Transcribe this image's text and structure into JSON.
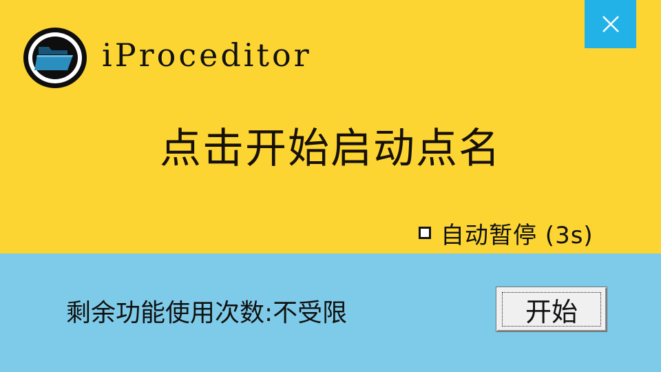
{
  "window": {
    "title": "iProceditor",
    "close_icon": "close-icon",
    "logo_icon": "folder-icon"
  },
  "main": {
    "prompt": "点击开始启动点名"
  },
  "options": {
    "auto_pause_label": "自动暂停 (3s)",
    "auto_pause_checked": false
  },
  "footer": {
    "remaining_label": "剩余功能使用次数:不受限",
    "start_button_label": "开始"
  },
  "colors": {
    "top_panel": "#fcd533",
    "bottom_panel": "#7ecbe9",
    "close_button": "#22b2e8"
  }
}
